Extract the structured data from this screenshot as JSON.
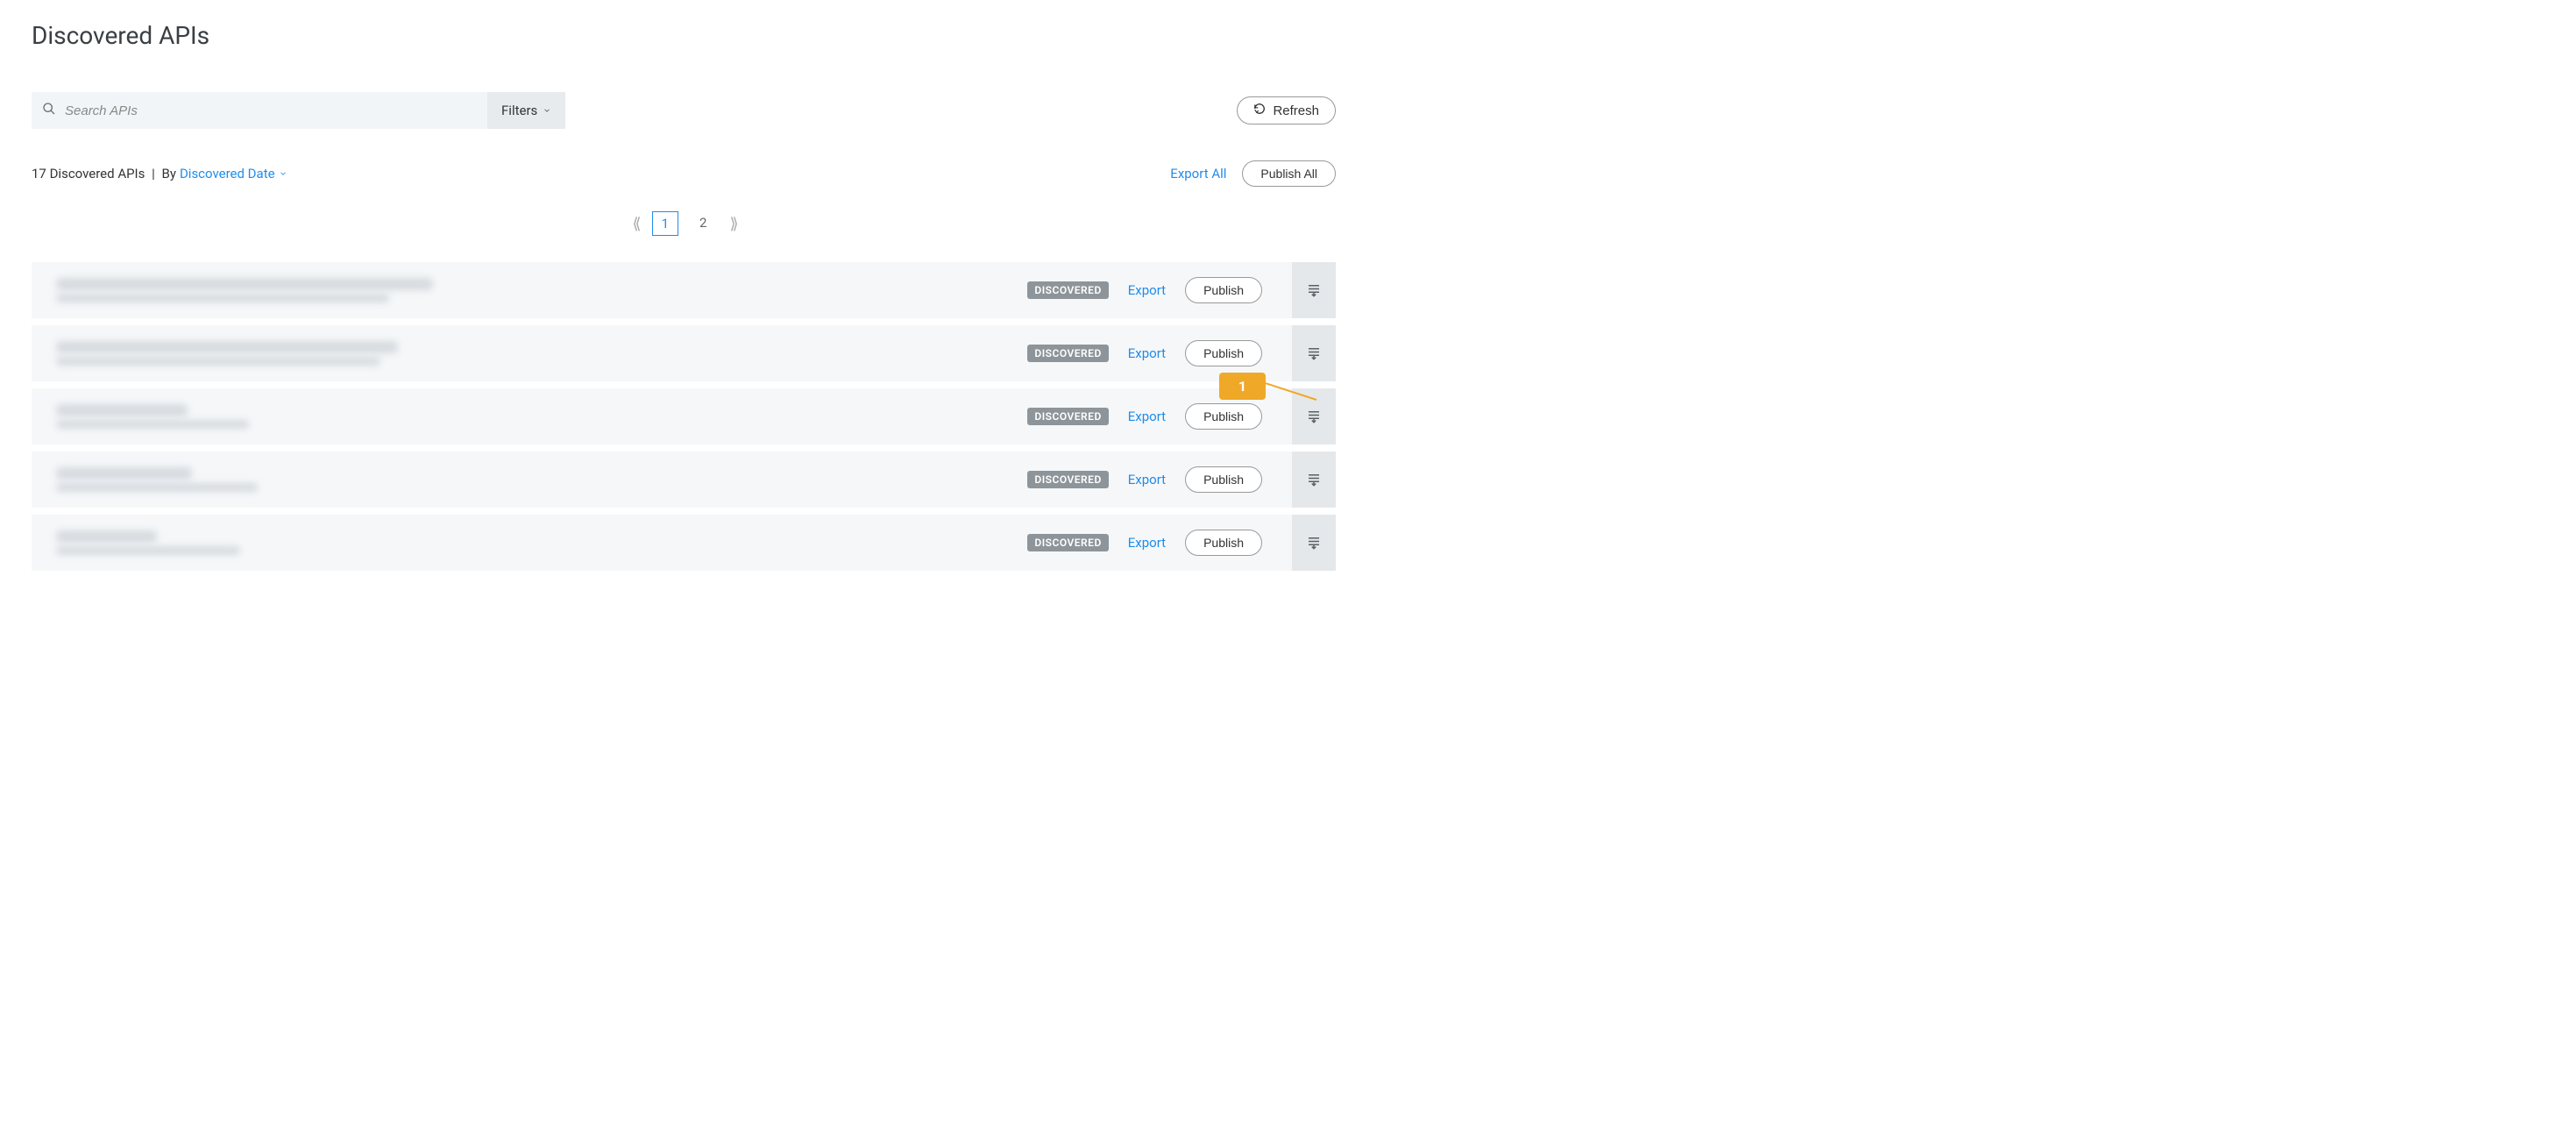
{
  "header": {
    "title": "Discovered APIs"
  },
  "search": {
    "placeholder": "Search APIs",
    "filters_label": "Filters",
    "refresh_label": "Refresh"
  },
  "meta": {
    "count_text": "17 Discovered APIs",
    "by_text": "By",
    "sort_label": "Discovered Date",
    "export_all_label": "Export All",
    "publish_all_label": "Publish All"
  },
  "pagination": {
    "pages": [
      "1",
      "2"
    ],
    "active": "1"
  },
  "rows": [
    {
      "status": "DISCOVERED",
      "export_label": "Export",
      "publish_label": "Publish",
      "title_w": 430,
      "sub_w": 380
    },
    {
      "status": "DISCOVERED",
      "export_label": "Export",
      "publish_label": "Publish",
      "title_w": 390,
      "sub_w": 370
    },
    {
      "status": "DISCOVERED",
      "export_label": "Export",
      "publish_label": "Publish",
      "title_w": 150,
      "sub_w": 220
    },
    {
      "status": "DISCOVERED",
      "export_label": "Export",
      "publish_label": "Publish",
      "title_w": 155,
      "sub_w": 230
    },
    {
      "status": "DISCOVERED",
      "export_label": "Export",
      "publish_label": "Publish",
      "title_w": 115,
      "sub_w": 210
    }
  ],
  "callout": {
    "text": "1",
    "row_index": 2
  }
}
